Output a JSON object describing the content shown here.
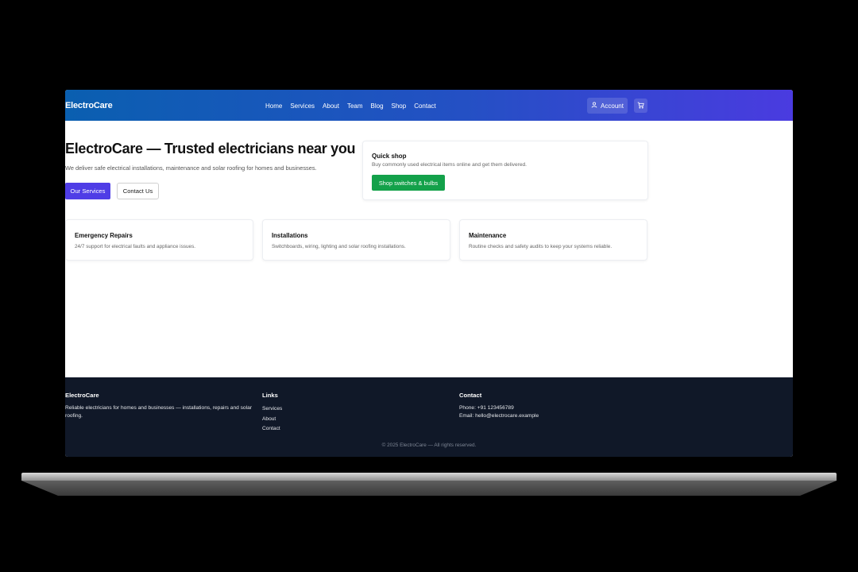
{
  "header": {
    "brand": "ElectroCare",
    "nav": [
      "Home",
      "Services",
      "About",
      "Team",
      "Blog",
      "Shop",
      "Contact"
    ],
    "account_label": "Account"
  },
  "hero": {
    "title": "ElectroCare — Trusted electricians near you",
    "subtitle": "We deliver safe electrical installations, maintenance and solar roofing for homes and businesses.",
    "primary_button": "Our Services",
    "secondary_button": "Contact Us"
  },
  "quick_shop": {
    "title": "Quick shop",
    "description": "Buy commonly used electrical items online and get them delivered.",
    "button": "Shop switches & bulbs"
  },
  "services": [
    {
      "title": "Emergency Repairs",
      "description": "24/7 support for electrical faults and appliance issues."
    },
    {
      "title": "Installations",
      "description": "Switchboards, wiring, lighting and solar roofing installations."
    },
    {
      "title": "Maintenance",
      "description": "Routine checks and safety audits to keep your systems reliable."
    }
  ],
  "footer": {
    "brand": "ElectroCare",
    "tagline": "Reliable electricians for homes and businesses — installations, repairs and solar roofing.",
    "links_heading": "Links",
    "links": [
      "Services",
      "About",
      "Contact"
    ],
    "contact_heading": "Contact",
    "phone": "Phone: +91 123456789",
    "email": "Email: hello@electrocare.example",
    "copyright": "© 2025 ElectroCare — All rights reserved."
  },
  "colors": {
    "header_gradient_start": "#0a5fb0",
    "header_gradient_end": "#4a3be0",
    "primary_button": "#4f3de6",
    "shop_button": "#13a14a",
    "footer_bg": "#101828"
  }
}
